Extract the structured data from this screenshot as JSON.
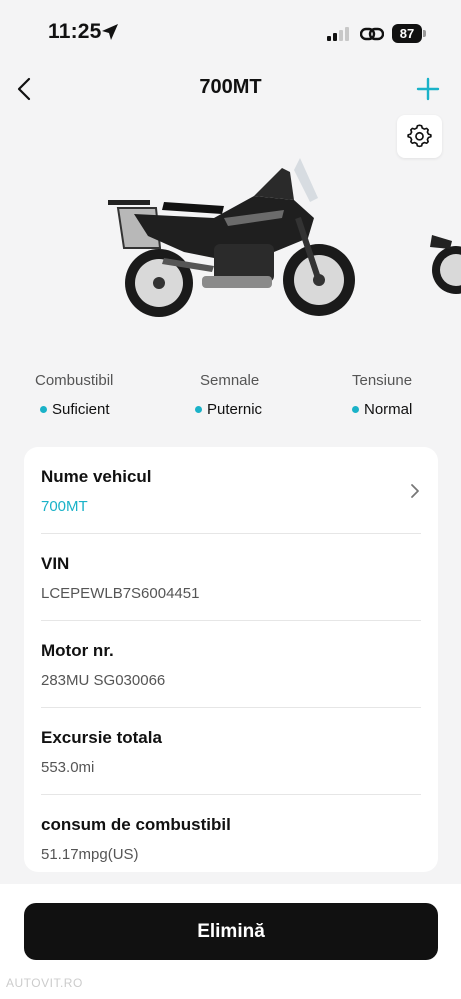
{
  "status_bar": {
    "time": "11:25",
    "battery": "87",
    "icons": [
      "location-arrow-icon",
      "cellular-signal-icon",
      "link-icon",
      "battery-icon"
    ]
  },
  "nav": {
    "title": "700MT",
    "back_icon": "chevron-left-icon",
    "add_icon": "plus-icon"
  },
  "settings_icon": "gear-icon",
  "accent_color": "#1ab2c8",
  "stats": [
    {
      "label": "Combustibil",
      "value": "Suficient"
    },
    {
      "label": "Semnale",
      "value": "Puternic"
    },
    {
      "label": "Tensiune",
      "value": "Normal"
    }
  ],
  "details": [
    {
      "title": "Nume vehicul",
      "value": "700MT"
    },
    {
      "title": "VIN",
      "value": "LCEPEWLB7S6004451"
    },
    {
      "title": "Motor nr.",
      "value": "283MU SG030066"
    },
    {
      "title": "Excursie totala",
      "value": "553.0mi"
    },
    {
      "title": "consum de combustibil",
      "value": "51.17mpg(US)"
    }
  ],
  "delete_button": "Elimină",
  "watermark": "AUTOVIT.RO"
}
